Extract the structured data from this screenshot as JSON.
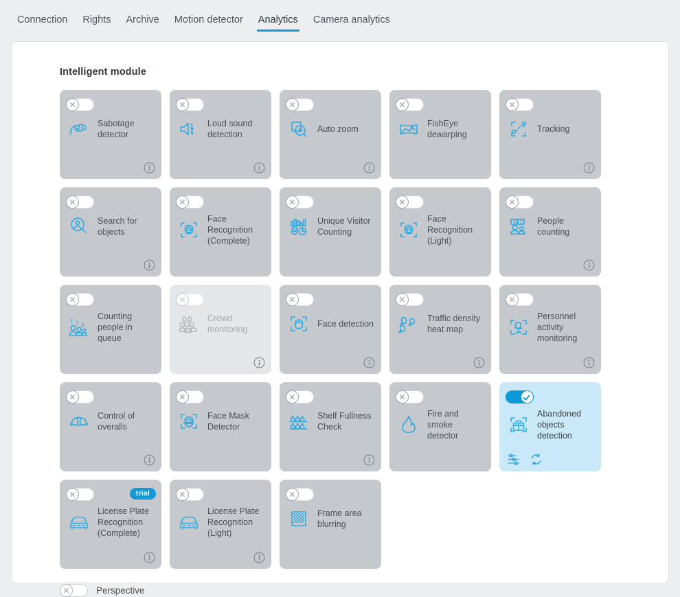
{
  "tabs": [
    {
      "label": "Connection",
      "active": false
    },
    {
      "label": "Rights",
      "active": false
    },
    {
      "label": "Archive",
      "active": false
    },
    {
      "label": "Motion detector",
      "active": false
    },
    {
      "label": "Analytics",
      "active": true
    },
    {
      "label": "Camera analytics",
      "active": false
    }
  ],
  "section": {
    "title": "Intelligent module"
  },
  "colors": {
    "accent": "#0e9ad9",
    "card_bg": "#c5c8cd",
    "card_bg_disabled": "#e4e7ea",
    "card_bg_active": "#c9e9f8",
    "page_bg": "#eceef0",
    "panel_bg": "#ffffff",
    "badge_bg": "#1499d6",
    "text": "#4a5058"
  },
  "modules": [
    {
      "label": "Sabotage detector",
      "icon": "sabotage-detector-icon",
      "state": "off",
      "info": true,
      "trial": false
    },
    {
      "label": "Loud sound detection",
      "icon": "loud-sound-icon",
      "state": "off",
      "info": true,
      "trial": false
    },
    {
      "label": "Auto zoom",
      "icon": "auto-zoom-icon",
      "state": "off",
      "info": true,
      "trial": false
    },
    {
      "label": "FishEye dewarping",
      "icon": "fisheye-dewarping-icon",
      "state": "off",
      "info": false,
      "trial": false
    },
    {
      "label": "Tracking",
      "icon": "tracking-icon",
      "state": "off",
      "info": true,
      "trial": false
    },
    {
      "label": "Search for objects",
      "icon": "search-objects-icon",
      "state": "off",
      "info": true,
      "trial": false
    },
    {
      "label": "Face Recognition (Complete)",
      "icon": "face-recognition-icon",
      "state": "off",
      "info": false,
      "trial": false
    },
    {
      "label": "Unique Visitor Counting",
      "icon": "unique-visitor-icon",
      "state": "off",
      "info": false,
      "trial": false
    },
    {
      "label": "Face Recognition (Light)",
      "icon": "face-recognition-icon",
      "state": "off",
      "info": false,
      "trial": false
    },
    {
      "label": "People counting",
      "icon": "people-counting-icon",
      "state": "off",
      "info": true,
      "trial": false
    },
    {
      "label": "Counting people in queue",
      "icon": "queue-counting-icon",
      "state": "off",
      "info": false,
      "trial": false
    },
    {
      "label": "Crowd monitoring",
      "icon": "crowd-monitoring-icon",
      "state": "disabled",
      "info": true,
      "trial": false
    },
    {
      "label": "Face detection",
      "icon": "face-detection-icon",
      "state": "off",
      "info": true,
      "trial": false
    },
    {
      "label": "Traffic density heat map",
      "icon": "heatmap-icon",
      "state": "off",
      "info": true,
      "trial": false
    },
    {
      "label": "Personnel activity monitoring",
      "icon": "personnel-activity-icon",
      "state": "off",
      "info": true,
      "trial": false
    },
    {
      "label": "Control of overalls",
      "icon": "helmet-icon",
      "state": "off",
      "info": true,
      "trial": false
    },
    {
      "label": "Face Mask Detector",
      "icon": "face-mask-icon",
      "state": "off",
      "info": false,
      "trial": false
    },
    {
      "label": "Shelf Fullness Check",
      "icon": "shelf-icon",
      "state": "off",
      "info": true,
      "trial": false
    },
    {
      "label": "Fire and smoke detector",
      "icon": "fire-icon",
      "state": "off",
      "info": false,
      "trial": false
    },
    {
      "label": "Abandoned objects detection",
      "icon": "abandoned-object-icon",
      "state": "on",
      "info": false,
      "trial": false,
      "actions": [
        "settings-sliders-icon",
        "refresh-icon"
      ]
    },
    {
      "label": "License Plate Recognition (Complete)",
      "icon": "license-plate-icon",
      "state": "off",
      "info": true,
      "trial": true,
      "trial_label": "trial"
    },
    {
      "label": "License Plate Recognition (Light)",
      "icon": "license-plate-icon",
      "state": "off",
      "info": true,
      "trial": false
    },
    {
      "label": "Frame area blurring",
      "icon": "frame-blur-icon",
      "state": "off",
      "info": false,
      "trial": false
    }
  ],
  "perspective": {
    "label": "Perspective",
    "state": "off"
  }
}
